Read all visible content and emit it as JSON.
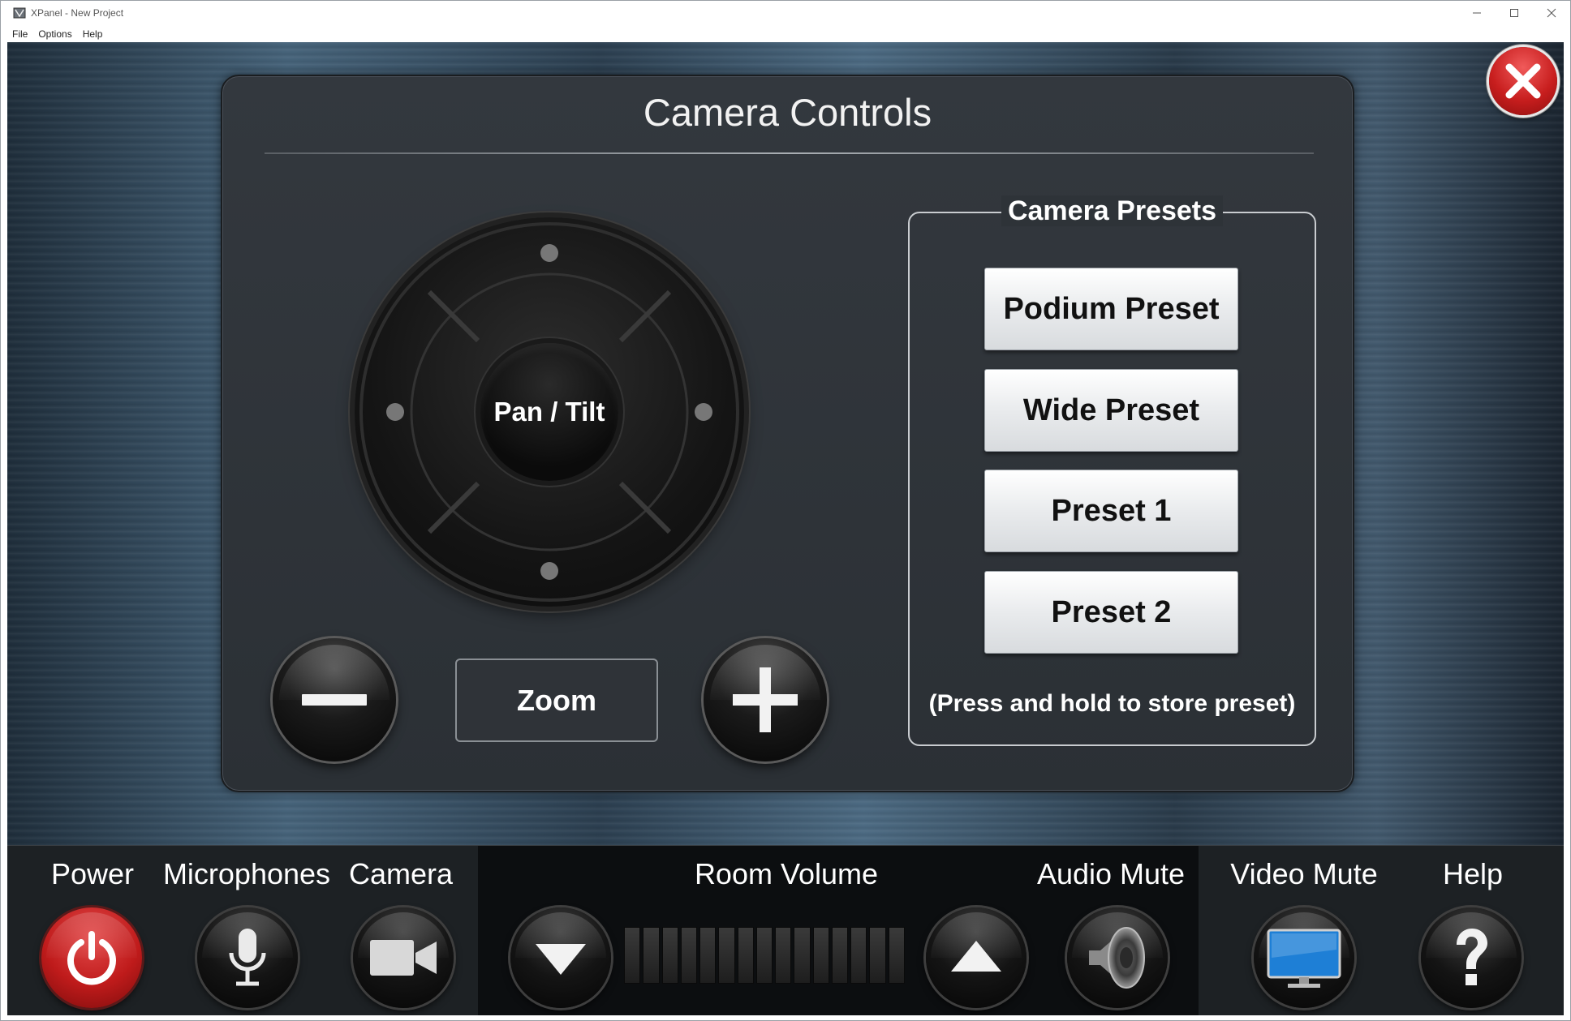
{
  "window": {
    "title": "XPanel - New Project",
    "controls": {
      "minimize": "—",
      "maximize": "☐",
      "close": "✕"
    }
  },
  "menubar": {
    "items": [
      "File",
      "Options",
      "Help"
    ]
  },
  "camera_controls": {
    "title": "Camera Controls",
    "pan_tilt_label": "Pan / Tilt",
    "zoom_label": "Zoom",
    "zoom_out_icon": "minus-icon",
    "zoom_in_icon": "plus-icon"
  },
  "presets": {
    "title": "Camera Presets",
    "buttons": [
      "Podium Preset",
      "Wide Preset",
      "Preset 1",
      "Preset 2"
    ],
    "note": "(Press and hold to store preset)"
  },
  "bottom_bar": {
    "power": "Power",
    "microphones": "Microphones",
    "camera": "Camera",
    "room_volume": "Room Volume",
    "audio_mute": "Audio Mute",
    "video_mute": "Video Mute",
    "help": "Help",
    "volume_level": 0
  },
  "colors": {
    "accent_red": "#c81e1e",
    "video_mute_blue": "#1e7fd6",
    "preset_button": "#e9ebed"
  }
}
